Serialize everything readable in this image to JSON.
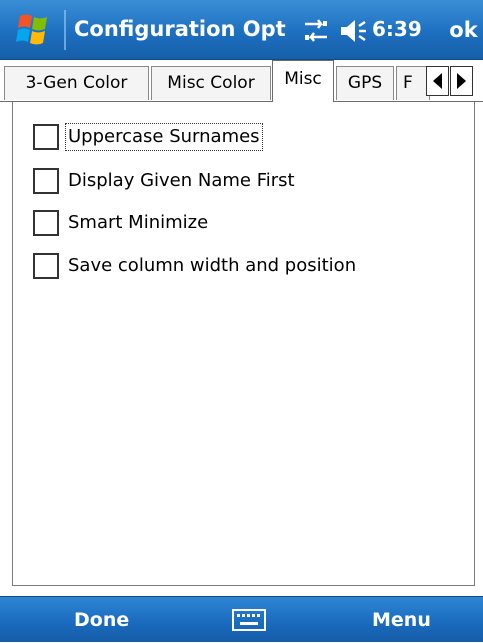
{
  "window": {
    "title": "Configuration Options",
    "clock": "6:39",
    "ok_label": "ok"
  },
  "tabs": [
    {
      "label": "3-Gen Color",
      "active": false
    },
    {
      "label": "Misc Color",
      "active": false
    },
    {
      "label": "Misc",
      "active": true
    },
    {
      "label": "GPS",
      "active": false
    },
    {
      "label": "F",
      "active": false
    }
  ],
  "options": [
    {
      "label": "Uppercase Surnames",
      "checked": false,
      "focused": true
    },
    {
      "label": "Display Given Name First",
      "checked": false,
      "focused": false
    },
    {
      "label": "Smart Minimize",
      "checked": false,
      "focused": false
    },
    {
      "label": "Save column width and position",
      "checked": false,
      "focused": false
    }
  ],
  "softkeys": {
    "left": "Done",
    "right": "Menu"
  },
  "icons": {
    "start": "windows-flag-icon",
    "connectivity": "connectivity-icon",
    "volume": "speaker-icon",
    "keyboard": "keyboard-icon",
    "scroll_left": "scroll-left-icon",
    "scroll_right": "scroll-right-icon"
  },
  "colors": {
    "bar_blue": "#1d6fc0",
    "text_white": "#ffffff"
  }
}
